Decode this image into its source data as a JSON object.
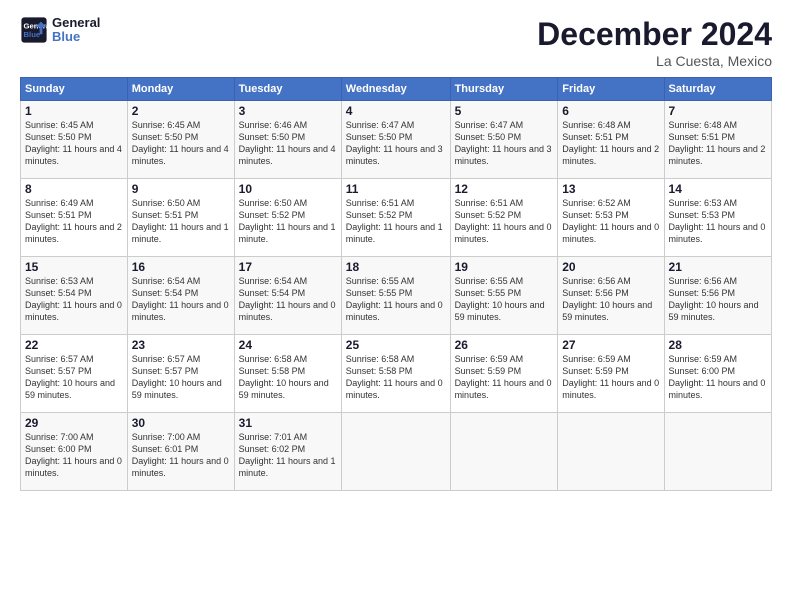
{
  "header": {
    "logo_line1": "General",
    "logo_line2": "Blue",
    "month": "December 2024",
    "location": "La Cuesta, Mexico"
  },
  "weekdays": [
    "Sunday",
    "Monday",
    "Tuesday",
    "Wednesday",
    "Thursday",
    "Friday",
    "Saturday"
  ],
  "weeks": [
    [
      {
        "day": "1",
        "sunrise": "Sunrise: 6:45 AM",
        "sunset": "Sunset: 5:50 PM",
        "daylight": "Daylight: 11 hours and 4 minutes."
      },
      {
        "day": "2",
        "sunrise": "Sunrise: 6:45 AM",
        "sunset": "Sunset: 5:50 PM",
        "daylight": "Daylight: 11 hours and 4 minutes."
      },
      {
        "day": "3",
        "sunrise": "Sunrise: 6:46 AM",
        "sunset": "Sunset: 5:50 PM",
        "daylight": "Daylight: 11 hours and 4 minutes."
      },
      {
        "day": "4",
        "sunrise": "Sunrise: 6:47 AM",
        "sunset": "Sunset: 5:50 PM",
        "daylight": "Daylight: 11 hours and 3 minutes."
      },
      {
        "day": "5",
        "sunrise": "Sunrise: 6:47 AM",
        "sunset": "Sunset: 5:50 PM",
        "daylight": "Daylight: 11 hours and 3 minutes."
      },
      {
        "day": "6",
        "sunrise": "Sunrise: 6:48 AM",
        "sunset": "Sunset: 5:51 PM",
        "daylight": "Daylight: 11 hours and 2 minutes."
      },
      {
        "day": "7",
        "sunrise": "Sunrise: 6:48 AM",
        "sunset": "Sunset: 5:51 PM",
        "daylight": "Daylight: 11 hours and 2 minutes."
      }
    ],
    [
      {
        "day": "8",
        "sunrise": "Sunrise: 6:49 AM",
        "sunset": "Sunset: 5:51 PM",
        "daylight": "Daylight: 11 hours and 2 minutes."
      },
      {
        "day": "9",
        "sunrise": "Sunrise: 6:50 AM",
        "sunset": "Sunset: 5:51 PM",
        "daylight": "Daylight: 11 hours and 1 minute."
      },
      {
        "day": "10",
        "sunrise": "Sunrise: 6:50 AM",
        "sunset": "Sunset: 5:52 PM",
        "daylight": "Daylight: 11 hours and 1 minute."
      },
      {
        "day": "11",
        "sunrise": "Sunrise: 6:51 AM",
        "sunset": "Sunset: 5:52 PM",
        "daylight": "Daylight: 11 hours and 1 minute."
      },
      {
        "day": "12",
        "sunrise": "Sunrise: 6:51 AM",
        "sunset": "Sunset: 5:52 PM",
        "daylight": "Daylight: 11 hours and 0 minutes."
      },
      {
        "day": "13",
        "sunrise": "Sunrise: 6:52 AM",
        "sunset": "Sunset: 5:53 PM",
        "daylight": "Daylight: 11 hours and 0 minutes."
      },
      {
        "day": "14",
        "sunrise": "Sunrise: 6:53 AM",
        "sunset": "Sunset: 5:53 PM",
        "daylight": "Daylight: 11 hours and 0 minutes."
      }
    ],
    [
      {
        "day": "15",
        "sunrise": "Sunrise: 6:53 AM",
        "sunset": "Sunset: 5:54 PM",
        "daylight": "Daylight: 11 hours and 0 minutes."
      },
      {
        "day": "16",
        "sunrise": "Sunrise: 6:54 AM",
        "sunset": "Sunset: 5:54 PM",
        "daylight": "Daylight: 11 hours and 0 minutes."
      },
      {
        "day": "17",
        "sunrise": "Sunrise: 6:54 AM",
        "sunset": "Sunset: 5:54 PM",
        "daylight": "Daylight: 11 hours and 0 minutes."
      },
      {
        "day": "18",
        "sunrise": "Sunrise: 6:55 AM",
        "sunset": "Sunset: 5:55 PM",
        "daylight": "Daylight: 11 hours and 0 minutes."
      },
      {
        "day": "19",
        "sunrise": "Sunrise: 6:55 AM",
        "sunset": "Sunset: 5:55 PM",
        "daylight": "Daylight: 10 hours and 59 minutes."
      },
      {
        "day": "20",
        "sunrise": "Sunrise: 6:56 AM",
        "sunset": "Sunset: 5:56 PM",
        "daylight": "Daylight: 10 hours and 59 minutes."
      },
      {
        "day": "21",
        "sunrise": "Sunrise: 6:56 AM",
        "sunset": "Sunset: 5:56 PM",
        "daylight": "Daylight: 10 hours and 59 minutes."
      }
    ],
    [
      {
        "day": "22",
        "sunrise": "Sunrise: 6:57 AM",
        "sunset": "Sunset: 5:57 PM",
        "daylight": "Daylight: 10 hours and 59 minutes."
      },
      {
        "day": "23",
        "sunrise": "Sunrise: 6:57 AM",
        "sunset": "Sunset: 5:57 PM",
        "daylight": "Daylight: 10 hours and 59 minutes."
      },
      {
        "day": "24",
        "sunrise": "Sunrise: 6:58 AM",
        "sunset": "Sunset: 5:58 PM",
        "daylight": "Daylight: 10 hours and 59 minutes."
      },
      {
        "day": "25",
        "sunrise": "Sunrise: 6:58 AM",
        "sunset": "Sunset: 5:58 PM",
        "daylight": "Daylight: 11 hours and 0 minutes."
      },
      {
        "day": "26",
        "sunrise": "Sunrise: 6:59 AM",
        "sunset": "Sunset: 5:59 PM",
        "daylight": "Daylight: 11 hours and 0 minutes."
      },
      {
        "day": "27",
        "sunrise": "Sunrise: 6:59 AM",
        "sunset": "Sunset: 5:59 PM",
        "daylight": "Daylight: 11 hours and 0 minutes."
      },
      {
        "day": "28",
        "sunrise": "Sunrise: 6:59 AM",
        "sunset": "Sunset: 6:00 PM",
        "daylight": "Daylight: 11 hours and 0 minutes."
      }
    ],
    [
      {
        "day": "29",
        "sunrise": "Sunrise: 7:00 AM",
        "sunset": "Sunset: 6:00 PM",
        "daylight": "Daylight: 11 hours and 0 minutes."
      },
      {
        "day": "30",
        "sunrise": "Sunrise: 7:00 AM",
        "sunset": "Sunset: 6:01 PM",
        "daylight": "Daylight: 11 hours and 0 minutes."
      },
      {
        "day": "31",
        "sunrise": "Sunrise: 7:01 AM",
        "sunset": "Sunset: 6:02 PM",
        "daylight": "Daylight: 11 hours and 1 minute."
      },
      null,
      null,
      null,
      null
    ]
  ]
}
